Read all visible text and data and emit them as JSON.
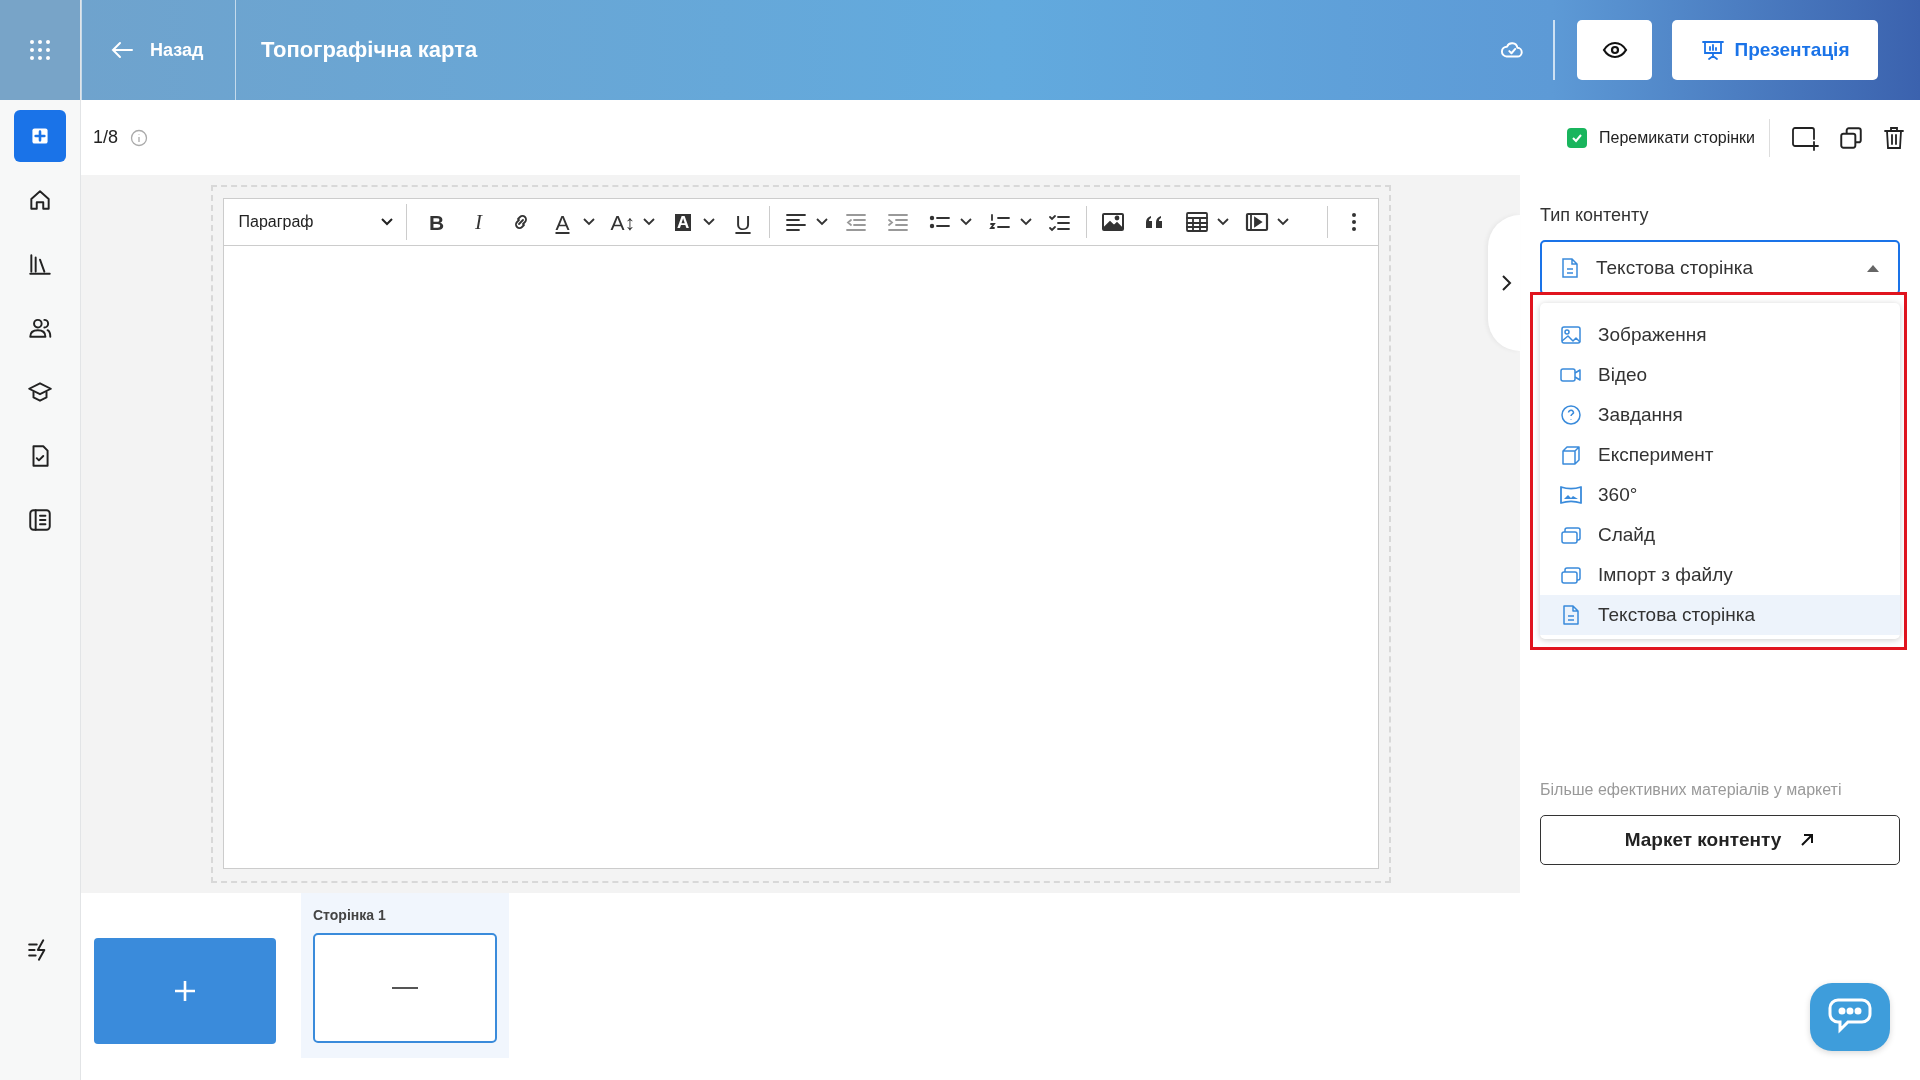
{
  "sidebar": {
    "items": [
      {
        "kind": "create",
        "selected": true
      },
      {
        "kind": "home",
        "selected": false
      },
      {
        "kind": "library",
        "selected": false
      },
      {
        "kind": "people",
        "selected": false
      },
      {
        "kind": "courses",
        "selected": false
      },
      {
        "kind": "tasks",
        "selected": false
      },
      {
        "kind": "journal",
        "selected": false
      }
    ],
    "bottom_item": {
      "kind": "lightning"
    }
  },
  "header": {
    "back_label": "Назад",
    "title": "Топографічна карта",
    "present_label": "Презентація"
  },
  "subbar": {
    "page_counter": "1/8",
    "switch_pages": {
      "label": "Перемикати сторінки",
      "checked": true
    }
  },
  "toolbar": {
    "block_format": "Параграф",
    "buttons": [
      {
        "kind": "bold",
        "glyph": "B"
      },
      {
        "kind": "italic",
        "glyph": "I"
      },
      {
        "kind": "link"
      },
      {
        "kind": "font-color",
        "glyph": "A"
      },
      {
        "kind": "caret"
      },
      {
        "kind": "font-size",
        "glyph": "A↕"
      },
      {
        "kind": "caret"
      },
      {
        "kind": "highlight",
        "glyph": "A"
      },
      {
        "kind": "caret"
      },
      {
        "kind": "underline",
        "glyph": "U"
      },
      {
        "kind": "separator"
      },
      {
        "kind": "align"
      },
      {
        "kind": "caret"
      },
      {
        "kind": "outdent"
      },
      {
        "kind": "indent"
      },
      {
        "kind": "bullets"
      },
      {
        "kind": "caret"
      },
      {
        "kind": "numbers"
      },
      {
        "kind": "caret"
      },
      {
        "kind": "checklist"
      },
      {
        "kind": "separator"
      },
      {
        "kind": "image"
      },
      {
        "kind": "quote"
      },
      {
        "kind": "table"
      },
      {
        "kind": "caret"
      },
      {
        "kind": "media"
      },
      {
        "kind": "caret"
      }
    ]
  },
  "content_type": {
    "label": "Тип контенту",
    "value": "Текстова сторінка",
    "expanded": true,
    "options": [
      {
        "kind": "image",
        "label": "Зображення",
        "selected": false
      },
      {
        "kind": "video",
        "label": "Відео",
        "selected": false
      },
      {
        "kind": "question",
        "label": "Завдання",
        "selected": false
      },
      {
        "kind": "cube",
        "label": "Експеримент",
        "selected": false
      },
      {
        "kind": "panorama",
        "label": "360°",
        "selected": false
      },
      {
        "kind": "slide",
        "label": "Слайд",
        "selected": false
      },
      {
        "kind": "slide",
        "label": "Імпорт з файлу",
        "selected": false
      },
      {
        "kind": "text-page",
        "label": "Текстова сторінка",
        "selected": true
      }
    ]
  },
  "market": {
    "hint": "Більше ефективних матеріалів у маркеті",
    "button_label": "Маркет контенту"
  },
  "pages": [
    {
      "label": "Сторінка 1",
      "selected": true
    }
  ]
}
